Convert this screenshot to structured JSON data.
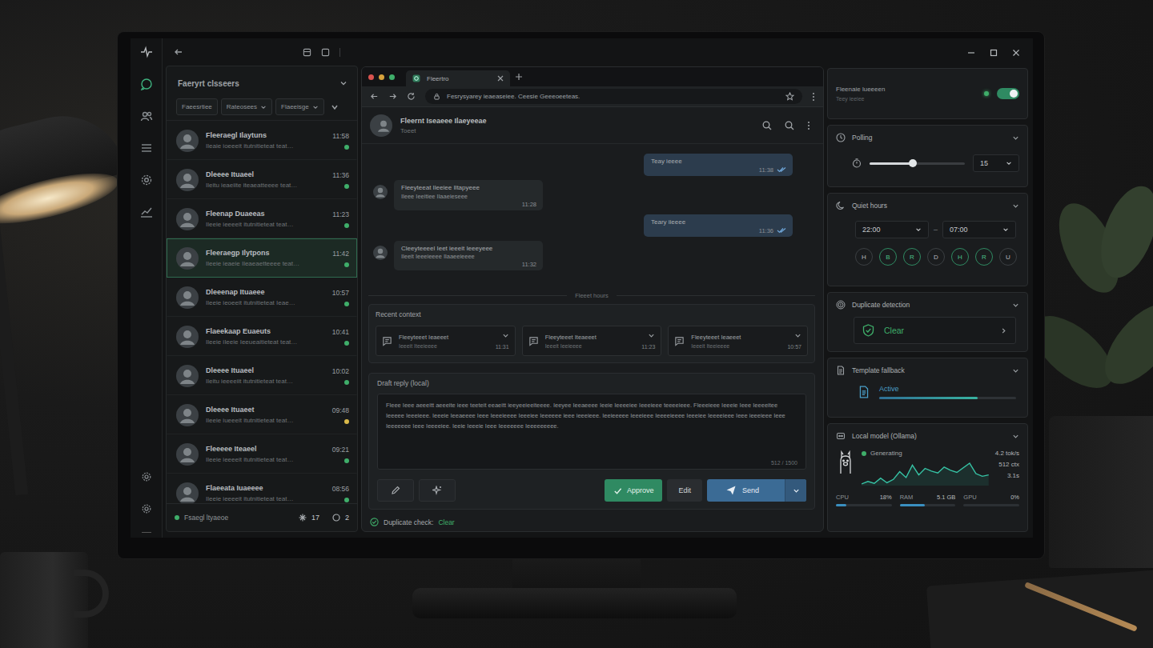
{
  "nav": [
    {
      "selected": true
    },
    {
      "selected": false
    },
    {
      "selected": false
    },
    {
      "selected": false
    },
    {
      "selected": false
    }
  ],
  "left_panel": {
    "header": "Faeryrt clsseers",
    "filters": [
      {
        "label": "Faeesrtiee",
        "dropdown": false
      },
      {
        "label": "Rateosees",
        "dropdown": true
      },
      {
        "label": "Flaeeisge",
        "dropdown": true
      }
    ],
    "conversations": [
      {
        "name": "Fleeraegl Ilaytuns",
        "preview": "Ileaie ioeeeit itutnitieteat teat…",
        "time": "11:58",
        "selected": false,
        "color": "#3fae6a"
      },
      {
        "name": "Dleeee Ituaeel",
        "preview": "Ileitu ieaeiite iteaeatteeee teat…",
        "time": "11:36",
        "selected": false,
        "color": "#3fae6a"
      },
      {
        "name": "Fleenap Duaeeas",
        "preview": "Ileeie ieeeeit itutnitieteat teat…",
        "time": "11:23",
        "selected": false,
        "color": "#3fae6a"
      },
      {
        "name": "Fleeraegp Ilytpons",
        "preview": "Ileeie ieaeie Ileaeaetteeee teat…",
        "time": "11:42",
        "selected": true,
        "color": "#3fae6a"
      },
      {
        "name": "Dleeenap Ituaeee",
        "preview": "Ileeie ieoeeit itutnitieteat Ieae…",
        "time": "10:57",
        "selected": false,
        "color": "#3fae6a"
      },
      {
        "name": "Flaeekaap Euaeuts",
        "preview": "Ileeie iIeeie Ieeueaitieteat teat…",
        "time": "10:41",
        "selected": false,
        "color": "#3fae6a"
      },
      {
        "name": "Dleeee Ituaeel",
        "preview": "Ileitu ieeeeiit itutnitieteat teat…",
        "time": "10:02",
        "selected": false,
        "color": "#3fae6a"
      },
      {
        "name": "Dleeee Ituaeet",
        "preview": "Ileeie iueeeit itutnitieteat teat…",
        "time": "09:48",
        "selected": false,
        "color": "#d9b94a"
      },
      {
        "name": "Fleeeee Iteaeel",
        "preview": "Ileeie ieeeeit itutnitieteat teat…",
        "time": "09:21",
        "selected": false,
        "color": "#3fae6a"
      },
      {
        "name": "Flaeeata Iuaeeee",
        "preview": "Ileeie ieeeeit itutnitieteat teat…",
        "time": "08:56",
        "selected": false,
        "color": "#3fae6a"
      }
    ],
    "footer": {
      "status": "Fsaegl ltyaeoe",
      "starred": "17",
      "pending": "2"
    }
  },
  "browser": {
    "tab": "Fleertro",
    "url": "Fesrysyarey ieaeaseiee. Ceesie Geeeoeeteas."
  },
  "chat": {
    "name": "Fleernt Iseaeee Ilaeyeeae",
    "subtitle": "Toeet",
    "messages": [
      {
        "direction": "out",
        "lines": [
          "Teay ieeee"
        ],
        "time": "11:38",
        "read": true
      },
      {
        "direction": "in",
        "lines": [
          "Fleeyteeat Ileeiee Iltapyeee",
          "Ileee Ieeitiee Ilaaeieseee"
        ],
        "time": "11:28",
        "read": false
      },
      {
        "direction": "out",
        "lines": [
          "Teary iieeee"
        ],
        "time": "11:36",
        "read": true
      },
      {
        "direction": "in",
        "lines": [
          "Cleeyteeeel Ieet ieeeit Ieeeyeee",
          "Ileeit Ieeeieeee Ilaaeeieeee"
        ],
        "time": "11:32",
        "read": false
      }
    ],
    "divider": "Fleeet hours"
  },
  "recent_context": {
    "label": "Recent context",
    "items": [
      {
        "title": "Fleeyteeet Ieaeeet",
        "subtitle": "Ieeeit Iteeieeee",
        "time": "11:31"
      },
      {
        "title": "Fleeyteeet Iteaeeet",
        "subtitle": "Ieeeit Ieeieeee",
        "time": "11:23"
      },
      {
        "title": "Fleeyteeet Ieaeeet",
        "subtitle": "Ieeeit Iteeieeee",
        "time": "10:57"
      }
    ]
  },
  "draft": {
    "label": "Draft reply (local)",
    "text": "Fleee Ieee aeeeitt aeeeite ieee teeteit eeaeitt ieeyeeieeiteeee. Ieeyee Ieeaeeee Ieeie Ieeeeiee Ieeeieee teeeeieee. Fleeeieee Ieeeie Ieee Ieeeeitee Ieeeee Ieeeieee. Ieeeie Ieeaeeee Ieee Ieeeieeee Ieeeiee Ieeeeee ieee ieeeieee. Ieeieeeee Ieeeieee Ieeeeieeee Ieeeiee Ieeeeieee Ieee ieeeieee Ieee Ieeeeeee Ieee Ieeeeiee. Ieeie Ieeeie Ieee Ieeeeeee Ieeeeeeeee.",
    "counter": "512 / 1500"
  },
  "actions": [
    {
      "label": "Approve",
      "kind": "approve"
    },
    {
      "label": "Edit",
      "kind": "plain"
    },
    {
      "label": "Send",
      "kind": "send"
    }
  ],
  "duplicate_check": {
    "label": "Duplicate check:",
    "value": "Clear"
  },
  "settings": {
    "auto_reply": {
      "title": "Fleenaie lueeeen",
      "subtitle": "Teey ieeiee",
      "on": true
    },
    "polling": {
      "title": "Polling",
      "level": 0.45,
      "value": "15"
    },
    "quiet_hours": {
      "title": "Quiet hours",
      "start": "22:00",
      "separator": "–",
      "end": "07:00",
      "days": [
        {
          "label": "H",
          "selected": false
        },
        {
          "label": "B",
          "selected": true
        },
        {
          "label": "R",
          "selected": true
        },
        {
          "label": "D",
          "selected": false
        },
        {
          "label": "H",
          "selected": true
        },
        {
          "label": "R",
          "selected": true
        },
        {
          "label": "U",
          "selected": false
        }
      ]
    },
    "duplicate_detection": {
      "title": "Duplicate detection",
      "status": "Clear"
    },
    "template_fallback": {
      "title": "Template fallback",
      "status": "Active",
      "level": 0.72
    },
    "local_model": {
      "title": "Local model (Ollama)",
      "status": "Generating",
      "stats": [
        "4.2 tok/s",
        "512 ctx",
        "3.1s"
      ],
      "series": [
        2.0,
        2.4,
        2.1,
        2.9,
        2.2,
        2.7,
        3.9,
        3.0,
        4.9,
        3.4,
        4.4,
        4.0,
        3.7,
        4.6,
        4.1,
        3.8,
        4.5,
        5.2,
        3.6,
        3.2,
        3.4
      ],
      "resources": [
        {
          "label": "CPU",
          "value": "18%",
          "level": 0.18
        },
        {
          "label": "RAM",
          "value": "5.1 GB",
          "level": 0.45
        },
        {
          "label": "GPU",
          "value": "0%",
          "level": 0.0
        }
      ]
    }
  }
}
